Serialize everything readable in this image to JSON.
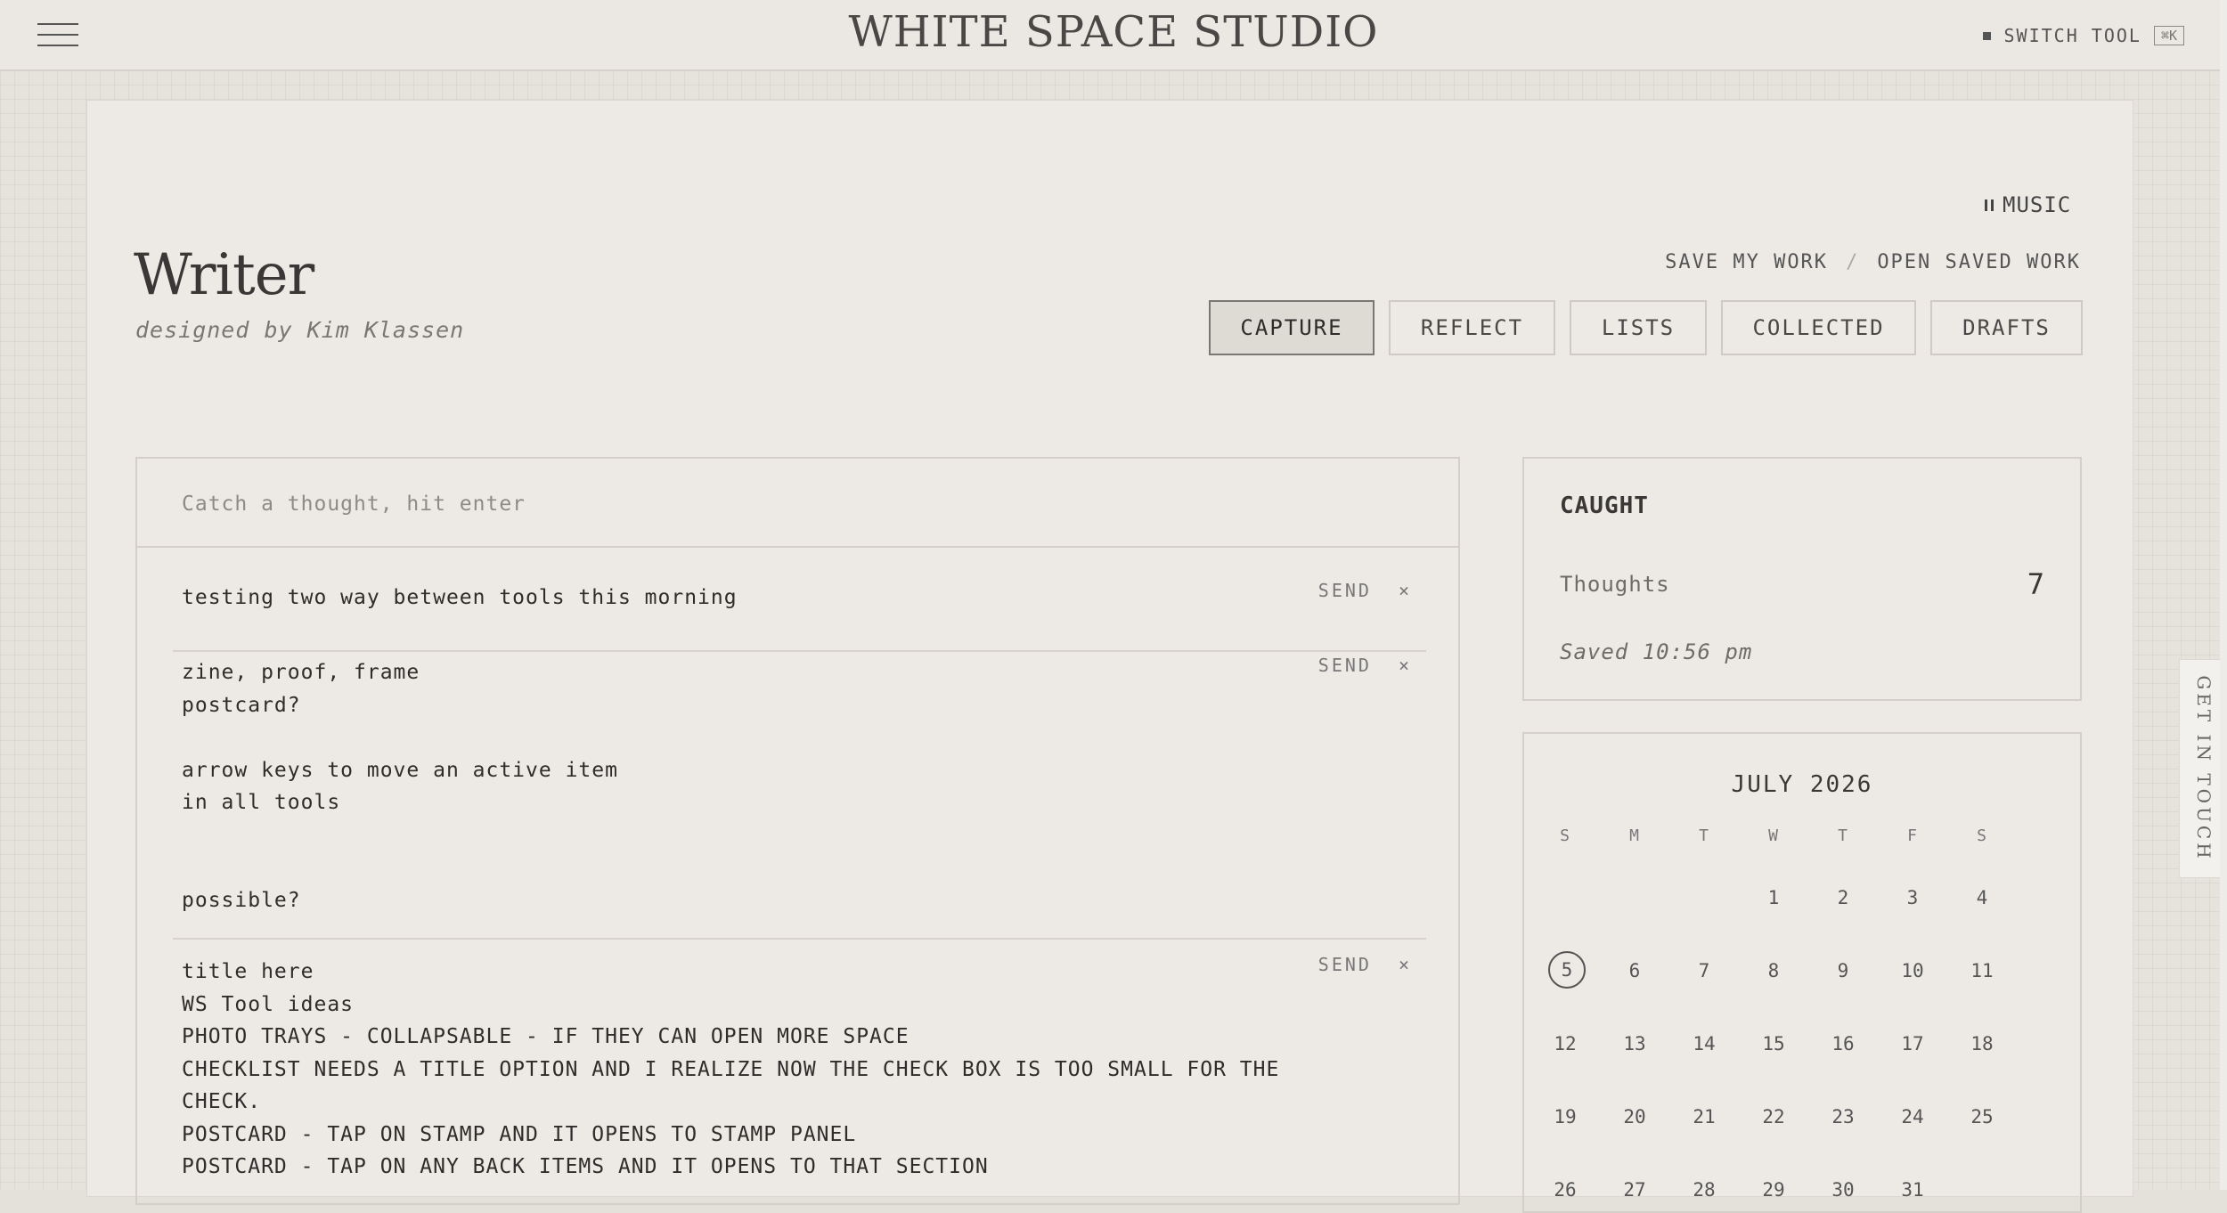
{
  "header": {
    "brand": "WHITE SPACE STUDIO",
    "switch_label": "SWITCH TOOL",
    "switch_shortcut": "⌘K",
    "menu_icon": "hamburger-icon"
  },
  "app": {
    "music_label": "MUSIC",
    "title": "Writer",
    "byline": "designed by Kim Klassen",
    "save_label": "SAVE MY WORK",
    "separator": "/",
    "open_label": "OPEN SAVED WORK",
    "tabs": [
      {
        "label": "CAPTURE",
        "active": true
      },
      {
        "label": "REFLECT",
        "active": false
      },
      {
        "label": "LISTS",
        "active": false
      },
      {
        "label": "COLLECTED",
        "active": false
      },
      {
        "label": "DRAFTS",
        "active": false
      }
    ]
  },
  "capture": {
    "placeholder": "Catch a thought, hit enter",
    "send_label": "SEND",
    "remove_label": "×",
    "thoughts": [
      {
        "text": "testing two way between tools this morning"
      },
      {
        "text": "zine, proof, frame\npostcard?\n\narrow keys to move an active item\nin all tools\n\n\npossible?"
      },
      {
        "text": "title here\nWS Tool ideas\nPHOTO TRAYS - COLLAPSABLE - IF THEY CAN OPEN MORE SPACE\nCHECKLIST NEEDS A TITLE OPTION AND I REALIZE NOW THE CHECK BOX IS TOO SMALL FOR THE\nCHECK.\nPOSTCARD - TAP ON STAMP AND IT OPENS TO STAMP PANEL\nPOSTCARD - TAP ON ANY BACK ITEMS AND IT OPENS TO THAT SECTION"
      }
    ]
  },
  "caught": {
    "heading": "CAUGHT",
    "thoughts_label": "Thoughts",
    "thoughts_count": "7",
    "saved_text": "Saved 10:56 pm"
  },
  "calendar": {
    "month": "JULY 2026",
    "weekdays": [
      "S",
      "M",
      "T",
      "W",
      "T",
      "F",
      "S"
    ],
    "today": "5",
    "weeks": [
      [
        "",
        "",
        "",
        "1",
        "2",
        "3",
        "4"
      ],
      [
        "5",
        "6",
        "7",
        "8",
        "9",
        "10",
        "11"
      ],
      [
        "12",
        "13",
        "14",
        "15",
        "16",
        "17",
        "18"
      ],
      [
        "19",
        "20",
        "21",
        "22",
        "23",
        "24",
        "25"
      ],
      [
        "26",
        "27",
        "28",
        "29",
        "30",
        "31",
        ""
      ]
    ]
  },
  "side_tab": {
    "label": "GET IN TOUCH"
  }
}
